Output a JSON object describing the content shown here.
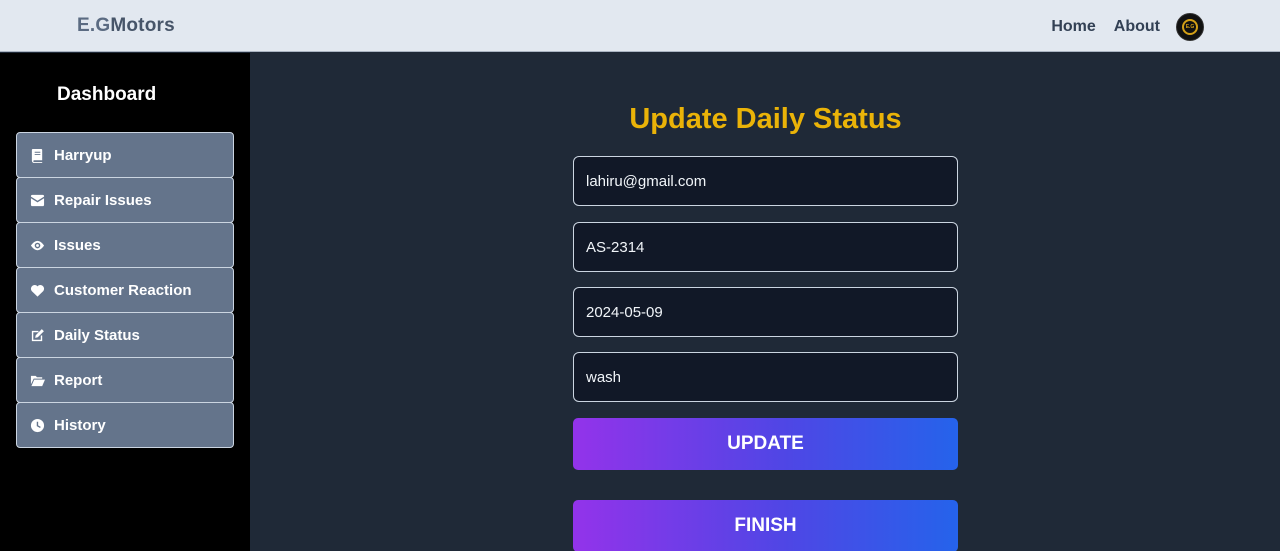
{
  "header": {
    "brand_prefix": "E.G",
    "brand_suffix": "Motors",
    "nav": [
      {
        "label": "Home"
      },
      {
        "label": "About"
      }
    ],
    "avatar_text": "E.G"
  },
  "sidebar": {
    "title": "Dashboard",
    "items": [
      {
        "label": "Harryup",
        "icon": "book-icon"
      },
      {
        "label": "Repair Issues",
        "icon": "envelope-icon"
      },
      {
        "label": "Issues",
        "icon": "eye-icon"
      },
      {
        "label": "Customer Reaction",
        "icon": "heart-icon"
      },
      {
        "label": "Daily Status",
        "icon": "edit-icon"
      },
      {
        "label": "Report",
        "icon": "folder-open-icon"
      },
      {
        "label": "History",
        "icon": "clock-icon"
      }
    ]
  },
  "form": {
    "title": "Update Daily Status",
    "email": "lahiru@gmail.com",
    "vehicle_number": "AS-2314",
    "date": "2024-05-09",
    "status": "wash",
    "update_label": "UPDATE",
    "finish_label": "FINISH"
  },
  "colors": {
    "accent_title": "#eab308",
    "sidebar_item_bg": "#64748b",
    "button_gradient_start": "#9333ea",
    "button_gradient_end": "#2563eb"
  }
}
